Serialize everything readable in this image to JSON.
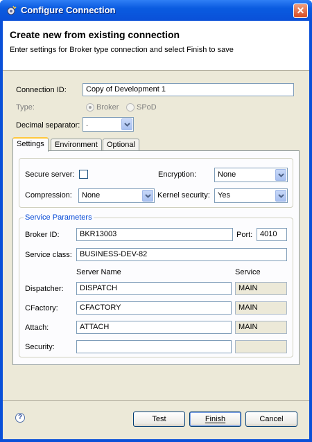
{
  "window": {
    "title": "Configure Connection",
    "close_label": "✕"
  },
  "banner": {
    "title": "Create new from existing connection",
    "description": "Enter settings for Broker type connection and select Finish to save"
  },
  "form": {
    "connection_id_label": "Connection ID:",
    "connection_id_value": "Copy of Development 1",
    "type_label": "Type:",
    "type_options": [
      "Broker",
      "SPoD"
    ],
    "type_selected": "Broker",
    "decimal_label": "Decimal separator:",
    "decimal_value": "."
  },
  "tabs": [
    "Settings",
    "Environment",
    "Optional"
  ],
  "tabs_active": "Settings",
  "settings": {
    "secure_server_label": "Secure server:",
    "secure_server_checked": false,
    "encryption_label": "Encryption:",
    "encryption_value": "None",
    "compression_label": "Compression:",
    "compression_value": "None",
    "kernel_security_label": "Kernel security:",
    "kernel_security_value": "Yes"
  },
  "service_params": {
    "group_title": "Service Parameters",
    "broker_id_label": "Broker ID:",
    "broker_id_value": "BKR13003",
    "port_label": "Port:",
    "port_value": "4010",
    "service_class_label": "Service class:",
    "service_class_value": "BUSINESS-DEV-82",
    "col_server_name": "Server Name",
    "col_service": "Service",
    "rows": [
      {
        "label": "Dispatcher:",
        "server": "DISPATCH",
        "service": "MAIN"
      },
      {
        "label": "CFactory:",
        "server": "CFACTORY",
        "service": "MAIN"
      },
      {
        "label": "Attach:",
        "server": "ATTACH",
        "service": "MAIN"
      },
      {
        "label": "Security:",
        "server": "",
        "service": ""
      }
    ]
  },
  "buttons": {
    "help": "?",
    "test": "Test",
    "finish": "Finish",
    "cancel": "Cancel"
  },
  "colors": {
    "titlebar": "#0a50d8",
    "dialog_bg": "#ece9d8",
    "group_title": "#0046d5",
    "tab_highlight": "#ffc83c"
  }
}
